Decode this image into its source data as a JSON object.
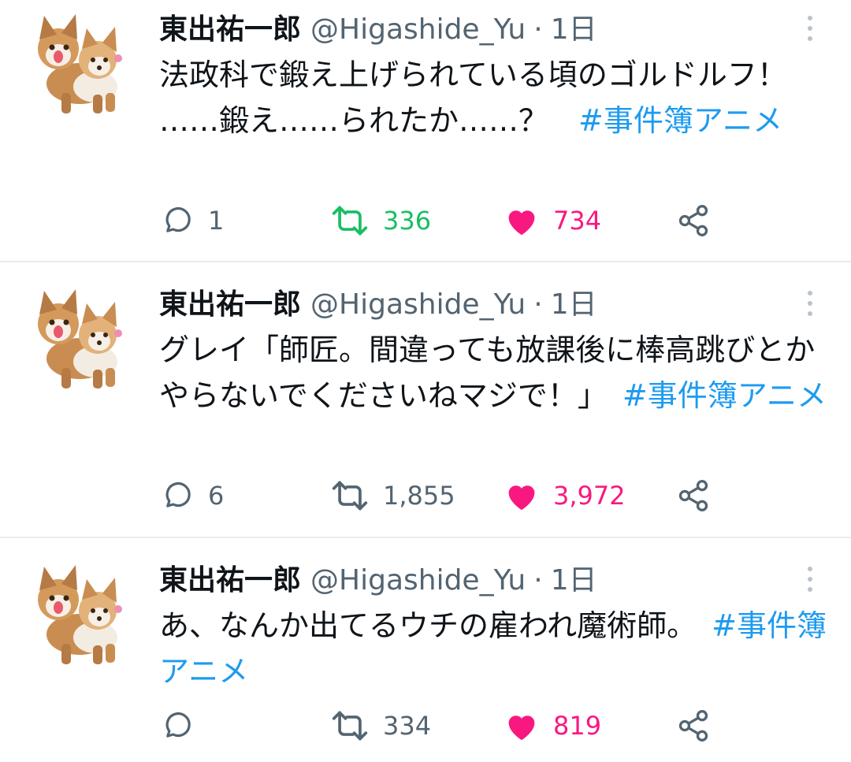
{
  "colors": {
    "retweet_active": "#17bf63",
    "like_active": "#f91880",
    "hashtag": "#1d9bf0",
    "secondary_text": "#536471",
    "divider": "#e6ecf0"
  },
  "tweets": [
    {
      "author_name": "東出祐一郎",
      "handle": "@Higashide_Yu",
      "separator": "·",
      "time": "1日",
      "text": "法政科で鍛え上げられている頃のゴルドルフ！　……鍛え……られたか……？　",
      "hashtag": "#事件簿アニメ",
      "reply_count": "1",
      "retweet_count": "336",
      "retweeted": true,
      "like_count": "734",
      "liked": true,
      "icons": [
        "reply-icon",
        "retweet-icon",
        "heart-icon",
        "share-icon",
        "more-icon"
      ]
    },
    {
      "author_name": "東出祐一郎",
      "handle": "@Higashide_Yu",
      "separator": "·",
      "time": "1日",
      "text": "グレイ「師匠。間違っても放課後に棒高跳びとかやらないでくださいねマジで！」　",
      "hashtag": "#事件簿アニメ",
      "reply_count": "6",
      "retweet_count": "1,855",
      "retweeted": false,
      "like_count": "3,972",
      "liked": true,
      "icons": [
        "reply-icon",
        "retweet-icon",
        "heart-icon",
        "share-icon",
        "more-icon"
      ]
    },
    {
      "author_name": "東出祐一郎",
      "handle": "@Higashide_Yu",
      "separator": "·",
      "time": "1日",
      "text": "あ、なんか出てるウチの雇われ魔術師。　",
      "hashtag": "#事件簿アニメ",
      "reply_count": "",
      "retweet_count": "334",
      "retweeted": false,
      "like_count": "819",
      "liked": true,
      "icons": [
        "reply-icon",
        "retweet-icon",
        "heart-icon",
        "share-icon",
        "more-icon"
      ]
    }
  ]
}
